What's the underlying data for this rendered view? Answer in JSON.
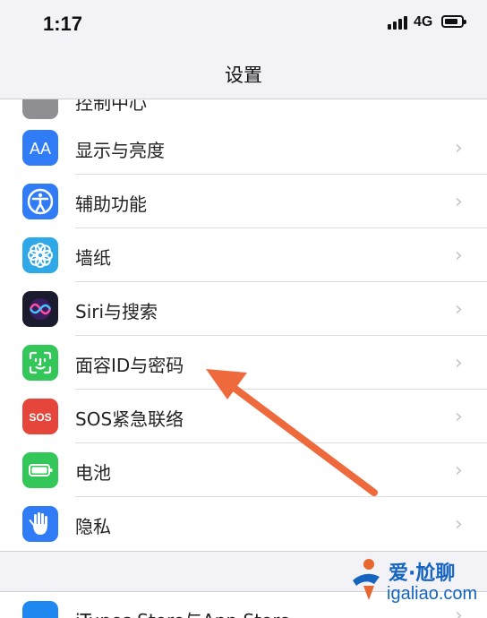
{
  "status_bar": {
    "time": "1:17",
    "network": "4G"
  },
  "nav": {
    "title": "设置"
  },
  "partial_top_item": {
    "label": "控制中心"
  },
  "items": [
    {
      "label": "显示与亮度",
      "icon": "display-brightness-icon",
      "color": "#2f7cf6"
    },
    {
      "label": "辅助功能",
      "icon": "accessibility-icon",
      "color": "#2f7cf6"
    },
    {
      "label": "墙纸",
      "icon": "wallpaper-flower-icon",
      "color": "#2ea8e6"
    },
    {
      "label": "Siri与搜索",
      "icon": "siri-icon",
      "color": "#1b1b2e"
    },
    {
      "label": "面容ID与密码",
      "icon": "face-id-icon",
      "color": "#33c759"
    },
    {
      "label": "SOS紧急联络",
      "icon": "sos-icon",
      "color": "#e5453a"
    },
    {
      "label": "电池",
      "icon": "battery-icon",
      "color": "#33c759"
    },
    {
      "label": "隐私",
      "icon": "privacy-hand-icon",
      "color": "#2f7cf6"
    }
  ],
  "bottom_item": {
    "label": "iTunes Store与App Store",
    "icon": "app-store-icon",
    "color": "#1e88f0"
  },
  "annotation": {
    "arrow_color": "#ee6a3c"
  },
  "watermark": {
    "line1": "爱·尬聊",
    "line2": "igaliao.com"
  }
}
